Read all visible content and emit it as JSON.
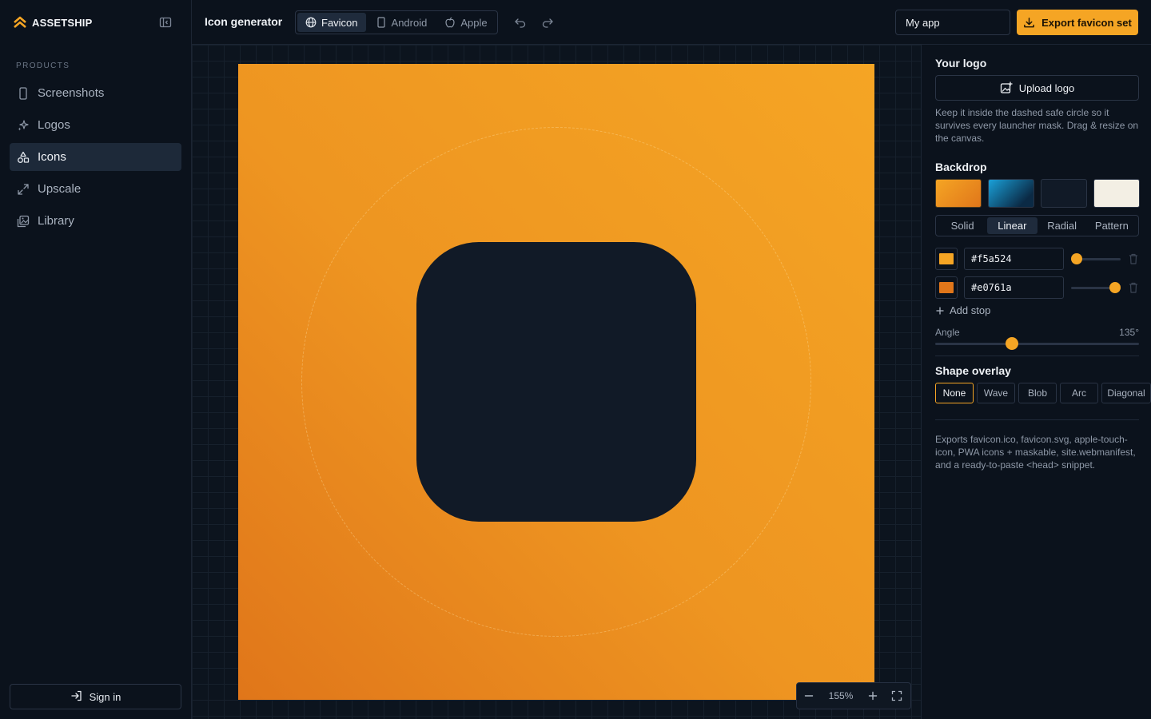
{
  "brand": {
    "name": "ASSETSHIP"
  },
  "sidebar": {
    "section_label": "PRODUCTS",
    "items": [
      {
        "label": "Screenshots",
        "icon": "phone-icon"
      },
      {
        "label": "Logos",
        "icon": "sparkles-icon"
      },
      {
        "label": "Icons",
        "icon": "shapes-icon",
        "active": true
      },
      {
        "label": "Upscale",
        "icon": "expand-icon"
      },
      {
        "label": "Library",
        "icon": "images-icon"
      }
    ],
    "sign_in_label": "Sign in"
  },
  "header": {
    "title": "Icon generator",
    "platform_tabs": [
      {
        "label": "Favicon",
        "icon": "globe-icon",
        "active": true
      },
      {
        "label": "Android",
        "icon": "phone-icon"
      },
      {
        "label": "Apple",
        "icon": "apple-icon"
      }
    ],
    "app_name_value": "My app",
    "export_label": "Export favicon set"
  },
  "canvas": {
    "zoom_label": "155%"
  },
  "panel": {
    "logo_heading": "Your logo",
    "upload_label": "Upload logo",
    "logo_hint": "Keep it inside the dashed safe circle so it survives every launcher mask. Drag & resize on the canvas.",
    "backdrop_heading": "Backdrop",
    "backdrop_tabs": [
      "Solid",
      "Linear",
      "Radial",
      "Pattern"
    ],
    "backdrop_active": "Linear",
    "stops": [
      {
        "hex": "#f5a524",
        "position": 0
      },
      {
        "hex": "#e0761a",
        "position": 1
      }
    ],
    "add_stop_label": "Add stop",
    "angle_label": "Angle",
    "angle_value": "135°",
    "angle_fraction": 0.375,
    "overlay_heading": "Shape overlay",
    "overlay_options": [
      "None",
      "Wave",
      "Blob",
      "Arc",
      "Diagonal"
    ],
    "overlay_active": "None",
    "export_note": "Exports favicon.ico, favicon.svg, apple-touch-icon, PWA icons + maskable, site.webmanifest, and a ready-to-paste <head> snippet."
  },
  "colors": {
    "accent": "#f5a524",
    "accent_dark": "#e0761a",
    "backdrop_swatches": [
      "orange-gradient",
      "blue-gradient",
      "dark-navy",
      "cream"
    ]
  }
}
